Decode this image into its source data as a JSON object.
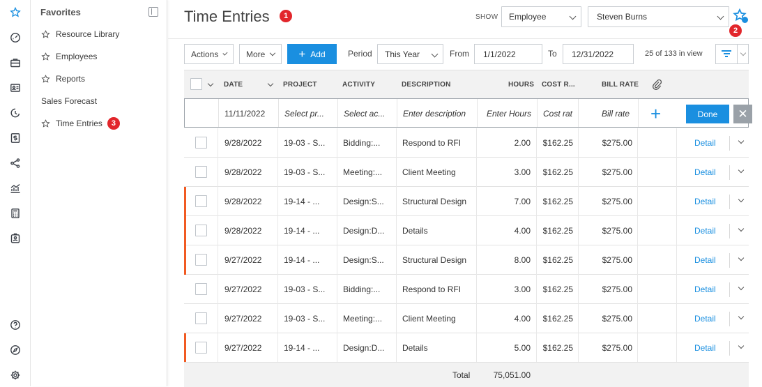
{
  "rail": {
    "icons": [
      "favorites-star-icon",
      "dashboard-gauge-icon",
      "projects-briefcase-icon",
      "contacts-card-icon",
      "time-clock-icon",
      "billing-dollar-icon",
      "workflow-share-icon",
      "reports-chart-icon",
      "calculator-icon",
      "employee-badge-icon",
      "help-icon",
      "compass-icon",
      "settings-gear-icon"
    ]
  },
  "favorites": {
    "title": "Favorites",
    "items": [
      {
        "label": "Resource Library",
        "star": true
      },
      {
        "label": "Employees",
        "star": true
      },
      {
        "label": "Reports",
        "star": true
      },
      {
        "label": "Sales Forecast",
        "star": false
      },
      {
        "label": "Time Entries",
        "star": true,
        "badge": "3"
      }
    ]
  },
  "header": {
    "title": "Time Entries",
    "title_badge": "1",
    "show_label": "SHOW",
    "show_type": "Employee",
    "show_value": "Steven Burns",
    "star_badge": "2"
  },
  "toolbar": {
    "actions": "Actions",
    "more": "More",
    "add": "Add",
    "period_label": "Period",
    "period_value": "This Year",
    "from_label": "From",
    "from_value": "1/1/2022",
    "to_label": "To",
    "to_value": "12/31/2022",
    "count": "25 of 133 in view"
  },
  "columns": {
    "date": "DATE",
    "project": "PROJECT",
    "activity": "ACTIVITY",
    "description": "DESCRIPTION",
    "hours": "HOURS",
    "cost_rate": "COST R...",
    "bill_rate": "BILL RATE"
  },
  "edit_row": {
    "date": "11/11/2022",
    "project_placeholder": "Select pr...",
    "activity_placeholder": "Select ac...",
    "description_placeholder": "Enter description",
    "hours_placeholder": "Enter Hours",
    "cost_placeholder": "Cost rat",
    "bill_placeholder": "Bill rate",
    "done": "Done"
  },
  "rows": [
    {
      "date": "9/28/2022",
      "project": "19-03 - S...",
      "activity": "Bidding:...",
      "description": "Respond to RFI",
      "hours": "2.00",
      "cost": "$162.25",
      "bill": "$275.00",
      "detail": "Detail",
      "flag": false
    },
    {
      "date": "9/28/2022",
      "project": "19-03 - S...",
      "activity": "Meeting:...",
      "description": "Client Meeting",
      "hours": "3.00",
      "cost": "$162.25",
      "bill": "$275.00",
      "detail": "Detail",
      "flag": false
    },
    {
      "date": "9/28/2022",
      "project": "19-14 - ...",
      "activity": "Design:S...",
      "description": "Structural Design",
      "hours": "7.00",
      "cost": "$162.25",
      "bill": "$275.00",
      "detail": "Detail",
      "flag": true
    },
    {
      "date": "9/28/2022",
      "project": "19-14 - ...",
      "activity": "Design:D...",
      "description": "Details",
      "hours": "4.00",
      "cost": "$162.25",
      "bill": "$275.00",
      "detail": "Detail",
      "flag": true
    },
    {
      "date": "9/27/2022",
      "project": "19-14 - ...",
      "activity": "Design:S...",
      "description": "Structural Design",
      "hours": "8.00",
      "cost": "$162.25",
      "bill": "$275.00",
      "detail": "Detail",
      "flag": true
    },
    {
      "date": "9/27/2022",
      "project": "19-03 - S...",
      "activity": "Bidding:...",
      "description": "Respond to RFI",
      "hours": "3.00",
      "cost": "$162.25",
      "bill": "$275.00",
      "detail": "Detail",
      "flag": false
    },
    {
      "date": "9/27/2022",
      "project": "19-03 - S...",
      "activity": "Meeting:...",
      "description": "Client Meeting",
      "hours": "4.00",
      "cost": "$162.25",
      "bill": "$275.00",
      "detail": "Detail",
      "flag": false
    },
    {
      "date": "9/27/2022",
      "project": "19-14 - ...",
      "activity": "Design:D...",
      "description": "Details",
      "hours": "5.00",
      "cost": "$162.25",
      "bill": "$275.00",
      "detail": "Detail",
      "flag": true
    }
  ],
  "footer": {
    "total_label": "Total",
    "total_value": "75,051.00"
  },
  "colors": {
    "accent": "#1a8fe0",
    "flag": "#f15a22",
    "badge": "#e2262b"
  }
}
